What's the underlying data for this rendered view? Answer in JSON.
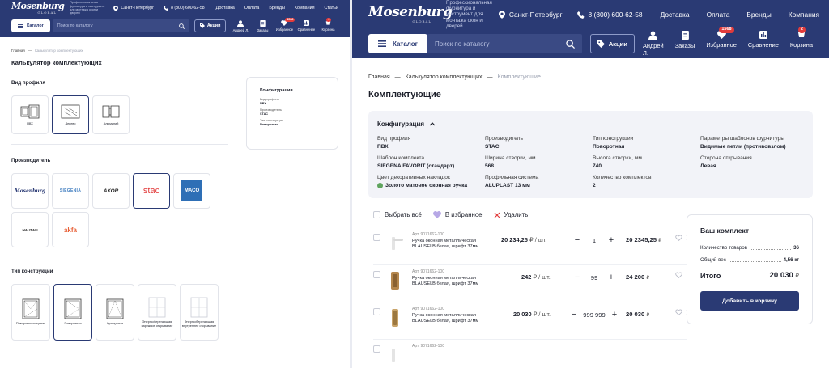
{
  "header": {
    "logo": "Mosenburg",
    "logo_sub": "GLOBAL",
    "tagline": "Профессиональная фурнитура и инструмент для монтажа окон и дверей",
    "city": "Санкт-Петербург",
    "phone": "8 (800) 600-62-58",
    "nav": [
      "Доставка",
      "Оплата",
      "Бренды",
      "Компания",
      "Статьи"
    ],
    "catalog_label": "Каталог",
    "search_placeholder": "Поиск по каталогу",
    "action_label": "Акции",
    "user_links": [
      {
        "label": "Андрей Л.",
        "icon": "user-icon"
      },
      {
        "label": "Заказы",
        "icon": "orders-icon"
      },
      {
        "label": "Избранное",
        "icon": "heart-icon",
        "badge": "1568"
      },
      {
        "label": "Сравнение",
        "icon": "compare-icon"
      },
      {
        "label": "Корзина",
        "icon": "cart-icon",
        "badge": "2"
      }
    ]
  },
  "left": {
    "breadcrumbs": [
      "Главная",
      "—",
      "Калькулятор комплектующих"
    ],
    "title": "Калькулятор комплектующих",
    "profile_title": "Вид профиля",
    "profiles": [
      {
        "label": "ПВХ"
      },
      {
        "label": "Дерево"
      },
      {
        "label": "Алюминий"
      }
    ],
    "manufacturer_title": "Производитель",
    "manufacturers": [
      {
        "label": "Mosenburg"
      },
      {
        "label": "SIEGENIA"
      },
      {
        "label": "AXOR"
      },
      {
        "label": "stac"
      },
      {
        "label": "MACO"
      },
      {
        "label": "HAUTAU"
      },
      {
        "label": "akfa"
      }
    ],
    "construction_title": "Тип конструкции",
    "constructions": [
      {
        "label": "Поворотно-откидная"
      },
      {
        "label": "Поворотная"
      },
      {
        "label": "Фрамужная"
      },
      {
        "label": "Энергосберегающая наружное открывание"
      },
      {
        "label": "Энергосберегающая внутреннее открывание"
      }
    ],
    "config": {
      "title": "Конфигурация",
      "items": [
        {
          "key": "Вид профиля",
          "value": "ПВХ"
        },
        {
          "key": "Производитель",
          "value": "STAC"
        },
        {
          "key": "Тип конструкции",
          "value": "Поворотная"
        }
      ]
    }
  },
  "right": {
    "breadcrumbs": [
      "Главная",
      "—",
      "Калькулятор комплектующих",
      "—",
      "Комплектующие"
    ],
    "title": "Комплектующие",
    "config": {
      "title": "Конфигурация",
      "items": [
        {
          "key": "Вид профиля",
          "value": "ПВХ"
        },
        {
          "key": "Производитель",
          "value": "STAC"
        },
        {
          "key": "Тип конструкции",
          "value": "Поворотная"
        },
        {
          "key": "Параметры шаблонов фурнитуры",
          "value": "Видимые петли (противовзлом)"
        },
        {
          "key": "Шаблон комплекта",
          "value": "SIEGENA FAVORIT (стандарт)"
        },
        {
          "key": "Ширина створки, мм",
          "value": "568"
        },
        {
          "key": "Высота створки, мм",
          "value": "740"
        },
        {
          "key": "Сторона открывания",
          "value": "Левая"
        },
        {
          "key": "Цвет декоративных накладок",
          "value": "Золото матовое оконная ручка"
        },
        {
          "key": "Профильная система",
          "value": "ALUPLAST 13 мм"
        },
        {
          "key": "Количество комплектов",
          "value": "2"
        }
      ]
    },
    "actions": {
      "select_all": "Выбрать всё",
      "to_favorites": "В избранное",
      "delete": "Удалить"
    },
    "rows": [
      {
        "art": "Арт. 9071662-100",
        "name": "Ручка оконная металлическая BLAUSELB белая, шрифт 37мм",
        "unit_price": "20 234,25",
        "unit_suffix": "₽ / шт.",
        "qty": "1",
        "total": "20 2345,25",
        "total_suffix": "₽"
      },
      {
        "art": "Арт. 9071662-100",
        "name": "Ручка оконная металлическая BLAUSELB белая, шрифт 37мм",
        "unit_price": "242",
        "unit_suffix": "₽ / шт.",
        "qty": "99",
        "total": "24 200",
        "total_suffix": "₽"
      },
      {
        "art": "Арт. 9071662-100",
        "name": "Ручка оконная металлическая BLAUSELB белая, шрифт 37мм",
        "unit_price": "20 030",
        "unit_suffix": "₽ / шт.",
        "qty": "999 999",
        "total": "20 030",
        "total_suffix": "₽"
      },
      {
        "art": "Арт. 9071662-100",
        "name": "",
        "unit_price": "",
        "unit_suffix": "",
        "qty": "",
        "total": "",
        "total_suffix": ""
      }
    ],
    "summary": {
      "title": "Ваш комплект",
      "count_label": "Количество товаров",
      "count_value": "36",
      "weight_label": "Общий вес",
      "weight_value": "4,56 кг",
      "total_label": "Итого",
      "total_value": "20 030",
      "currency": "₽",
      "add_to_cart": "Добавить в корзину"
    }
  },
  "colors": {
    "brand": "#2a3a74",
    "accent_red": "#e23b3b",
    "swatch_gold": "#5fa45e"
  }
}
